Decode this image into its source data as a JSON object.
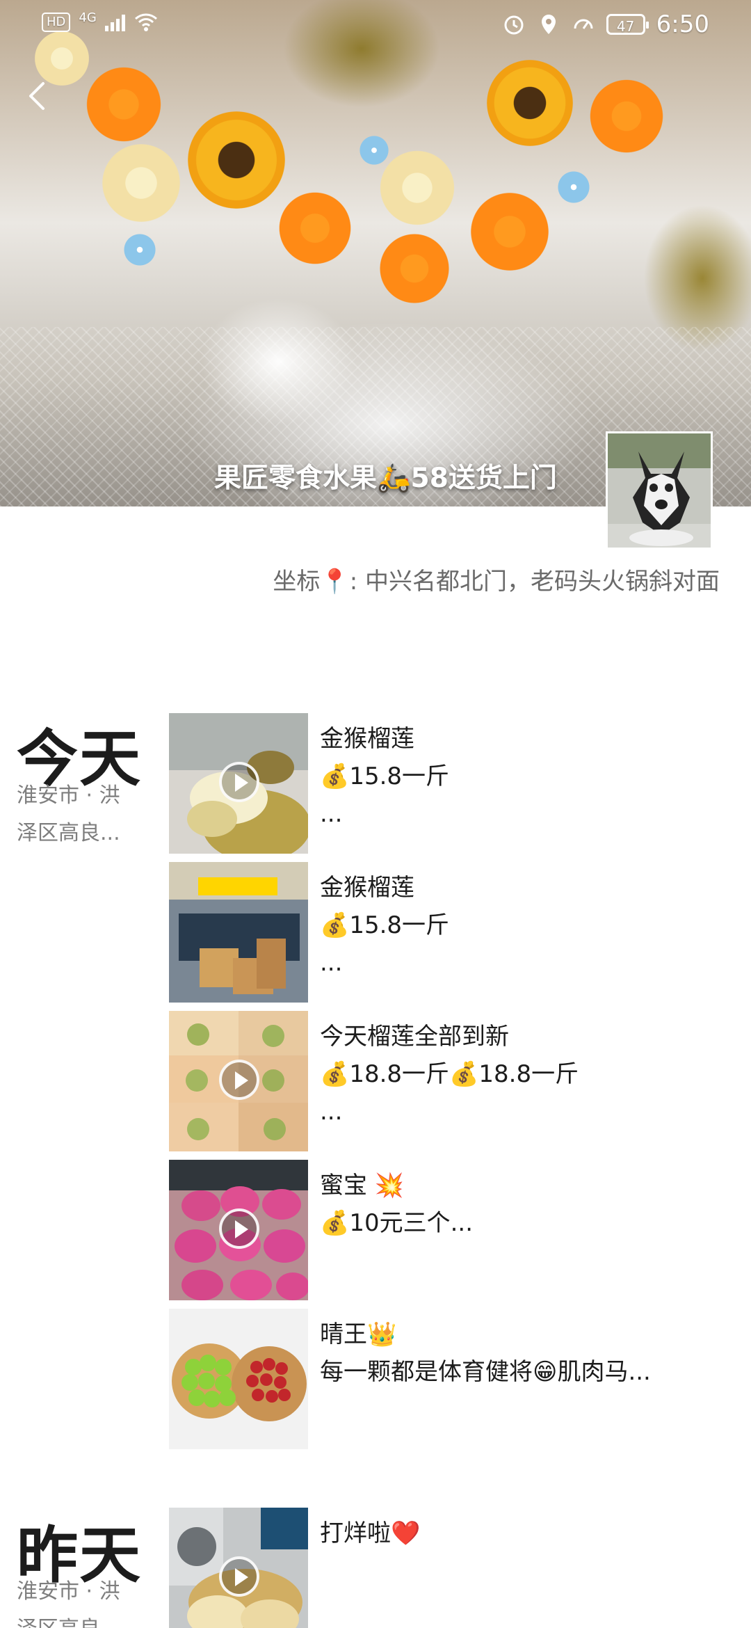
{
  "status_bar": {
    "left_badges": [
      "HD",
      "4G"
    ],
    "battery": "47",
    "time": "6:50"
  },
  "cover": {
    "profile_name": "果匠零食水果🛵58送货上门",
    "signature": "坐标📍: 中兴名都北门，老码头火锅斜对面",
    "avatar_icon": "husky-avatar"
  },
  "timeline": {
    "groups": [
      {
        "day": "今天",
        "location": "淮安市 · 洪泽区高良...",
        "posts": [
          {
            "lines": [
              "金猴榴莲",
              "💰15.8一斤",
              "..."
            ],
            "has_video": true
          },
          {
            "lines": [
              "金猴榴莲",
              "💰15.8一斤",
              "..."
            ],
            "has_video": false
          },
          {
            "lines": [
              "今天榴莲全部到新",
              "💰18.8一斤💰18.8一斤",
              "..."
            ],
            "has_video": true
          },
          {
            "lines": [
              "蜜宝 💥",
              "",
              "💰10元三个..."
            ],
            "has_video": true
          },
          {
            "lines": [
              "晴王👑",
              "",
              "每一颗都是体育健将😁肌肉马..."
            ],
            "has_video": false
          }
        ]
      },
      {
        "day": "昨天",
        "location": "淮安市 · 洪泽区高良...",
        "posts": [
          {
            "lines": [
              "打烊啦❤️",
              "",
              ""
            ],
            "has_video": true
          }
        ]
      }
    ]
  },
  "colors": {
    "text_primary": "#1c1c1c",
    "text_secondary": "#7e7e7e",
    "white": "#ffffff",
    "accent_orange": "#f7a312"
  }
}
